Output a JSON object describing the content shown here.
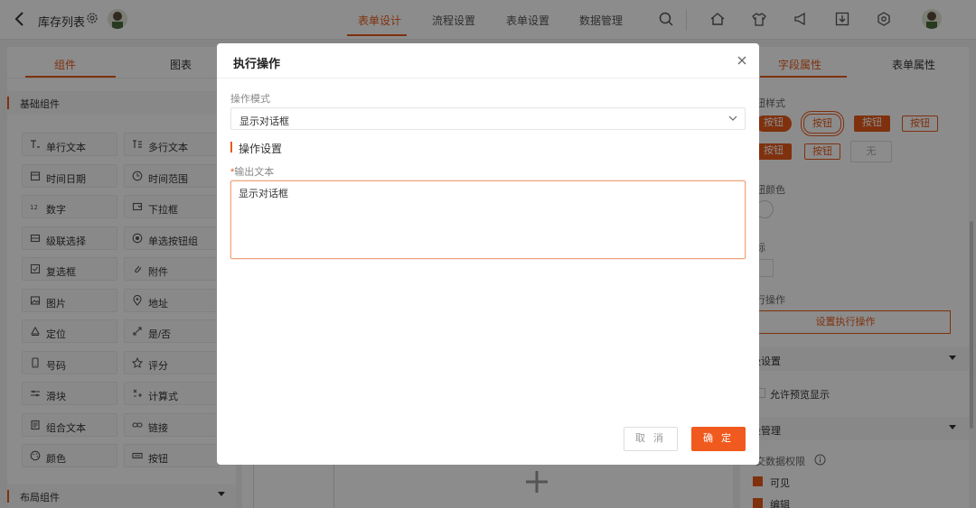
{
  "header": {
    "title": "库存列表",
    "tabs": [
      "表单设计",
      "流程设置",
      "表单设置",
      "数据管理"
    ],
    "icons": [
      "search-icon",
      "home-icon",
      "shirt-icon",
      "megaphone-icon",
      "download-icon",
      "settings-icon"
    ]
  },
  "left_panel": {
    "tabs": [
      "组件",
      "图表"
    ],
    "basic_section": "基础组件",
    "layout_section": "布局组件",
    "components": [
      {
        "label": "单行文本",
        "icon": "single-line-text-icon"
      },
      {
        "label": "多行文本",
        "icon": "multi-line-text-icon"
      },
      {
        "label": "时间日期",
        "icon": "datetime-icon"
      },
      {
        "label": "时间范围",
        "icon": "time-range-icon"
      },
      {
        "label": "数字",
        "icon": "number-icon"
      },
      {
        "label": "下拉框",
        "icon": "dropdown-icon"
      },
      {
        "label": "级联选择",
        "icon": "cascade-icon"
      },
      {
        "label": "单选按钮组",
        "icon": "radio-icon"
      },
      {
        "label": "复选框",
        "icon": "checkbox-icon"
      },
      {
        "label": "附件",
        "icon": "attachment-icon"
      },
      {
        "label": "图片",
        "icon": "image-icon"
      },
      {
        "label": "地址",
        "icon": "location-pin-icon"
      },
      {
        "label": "定位",
        "icon": "position-icon"
      },
      {
        "label": "是/否",
        "icon": "toggle-arrows-icon"
      },
      {
        "label": "号码",
        "icon": "phone-icon"
      },
      {
        "label": "评分",
        "icon": "star-icon"
      },
      {
        "label": "滑块",
        "icon": "slider-icon"
      },
      {
        "label": "计算式",
        "icon": "formula-icon"
      },
      {
        "label": "组合文本",
        "icon": "combo-text-icon"
      },
      {
        "label": "链接",
        "icon": "link-icon"
      },
      {
        "label": "颜色",
        "icon": "palette-icon"
      },
      {
        "label": "按钮",
        "icon": "button-icon"
      }
    ]
  },
  "right_panel": {
    "tabs": [
      "字段属性",
      "表单属性"
    ],
    "button_style_label": "钮样式",
    "button_styles": [
      "按钮",
      "按钮",
      "按钮",
      "按钮",
      "按钮",
      "按钮",
      "无"
    ],
    "button_color_label": "钮颜色",
    "icon_label": "标",
    "action_label": "行操作",
    "action_button": "设置执行操作",
    "advanced_section": "级设置",
    "allow_preview": "允许预览显示",
    "field_section": "段管理",
    "permission_label": "交数据权限",
    "visible": "可见",
    "editable": "编辑"
  },
  "modal": {
    "title": "执行操作",
    "mode_label": "操作模式",
    "mode_value": "显示对话框",
    "settings_header": "操作设置",
    "output_required_mark": "*",
    "output_label": "输出文本",
    "output_value": "显示对话框",
    "cancel": "取 消",
    "confirm": "确 定"
  },
  "colors": {
    "accent": "#e8591a",
    "confirm_button": "#f05a1e"
  }
}
